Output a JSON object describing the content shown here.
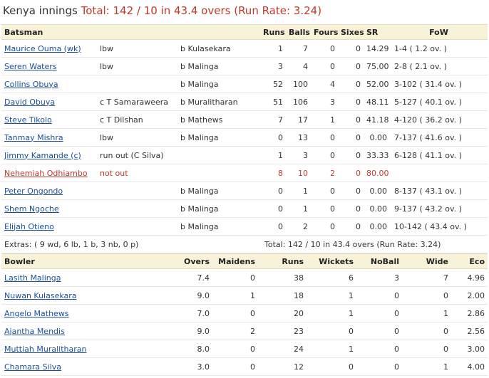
{
  "title": {
    "team": "Kenya innings",
    "total": "Total: 142 / 10 in 43.4 overs (Run Rate: 3.24)"
  },
  "batting": {
    "headers": {
      "batsman": "Batsman",
      "runs": "Runs",
      "balls": "Balls",
      "fours": "Fours",
      "sixes": "Sixes",
      "sr": "SR",
      "fow": "FoW"
    },
    "rows": [
      {
        "name": "Maurice Ouma (wk)",
        "how": "lbw",
        "bowler": "b Kulasekara",
        "runs": "1",
        "balls": "7",
        "fours": "0",
        "sixes": "0",
        "sr": "14.29",
        "fow": "1-4 ( 1.2 ov. )"
      },
      {
        "name": "Seren Waters",
        "how": "lbw",
        "bowler": "b Malinga",
        "runs": "3",
        "balls": "4",
        "fours": "0",
        "sixes": "0",
        "sr": "75.00",
        "fow": "2-8 ( 2.1 ov. )"
      },
      {
        "name": "Collins Obuya",
        "how": "",
        "bowler": "b Malinga",
        "runs": "52",
        "balls": "100",
        "fours": "4",
        "sixes": "0",
        "sr": "52.00",
        "fow": "3-102 ( 31.4 ov. )"
      },
      {
        "name": "David Obuya",
        "how": "c T Samaraweera",
        "bowler": "b Muralitharan",
        "runs": "51",
        "balls": "106",
        "fours": "3",
        "sixes": "0",
        "sr": "48.11",
        "fow": "5-127 ( 40.1 ov. )"
      },
      {
        "name": "Steve Tikolo",
        "how": "c T Dilshan",
        "bowler": "b Mathews",
        "runs": "7",
        "balls": "17",
        "fours": "1",
        "sixes": "0",
        "sr": "41.18",
        "fow": "4-120 ( 36.2 ov. )"
      },
      {
        "name": "Tanmay Mishra",
        "how": "lbw",
        "bowler": "b Malinga",
        "runs": "0",
        "balls": "13",
        "fours": "0",
        "sixes": "0",
        "sr": "0.00",
        "fow": "7-137 ( 41.6 ov. )"
      },
      {
        "name": "Jimmy Kamande (c)",
        "how": "run out (C Silva)",
        "bowler": "",
        "runs": "1",
        "balls": "3",
        "fours": "0",
        "sixes": "0",
        "sr": "33.33",
        "fow": "6-128 ( 41.1 ov. )"
      },
      {
        "name": "Nehemiah Odhiambo",
        "how": "not out",
        "bowler": "",
        "runs": "8",
        "balls": "10",
        "fours": "2",
        "sixes": "0",
        "sr": "80.00",
        "fow": "",
        "notout": true
      },
      {
        "name": "Peter Ongondo",
        "how": "",
        "bowler": "b Malinga",
        "runs": "0",
        "balls": "1",
        "fours": "0",
        "sixes": "0",
        "sr": "0.00",
        "fow": "8-137 ( 43.1 ov. )"
      },
      {
        "name": "Shem Ngoche",
        "how": "",
        "bowler": "b Malinga",
        "runs": "0",
        "balls": "1",
        "fours": "0",
        "sixes": "0",
        "sr": "0.00",
        "fow": "9-137 ( 43.2 ov. )"
      },
      {
        "name": "Elijah Otieno",
        "how": "",
        "bowler": "b Malinga",
        "runs": "0",
        "balls": "2",
        "fours": "0",
        "sixes": "0",
        "sr": "0.00",
        "fow": "10-142 ( 43.4 ov. )"
      }
    ],
    "extras": "Extras: ( 9 wd, 6 lb, 1 b, 3 nb, 0 p)",
    "total": "Total: 142 / 10 in 43.4 overs (Run Rate: 3.24)"
  },
  "bowling": {
    "headers": {
      "bowler": "Bowler",
      "overs": "Overs",
      "maidens": "Maidens",
      "runs": "Runs",
      "wickets": "Wickets",
      "noball": "NoBall",
      "wide": "Wide",
      "eco": "Eco"
    },
    "rows": [
      {
        "name": "Lasith Malinga",
        "overs": "7.4",
        "maidens": "0",
        "runs": "38",
        "wickets": "6",
        "noball": "3",
        "wide": "7",
        "eco": "4.96"
      },
      {
        "name": "Nuwan Kulasekara",
        "overs": "9.0",
        "maidens": "1",
        "runs": "18",
        "wickets": "1",
        "noball": "0",
        "wide": "0",
        "eco": "2.00"
      },
      {
        "name": "Angelo Mathews",
        "overs": "7.0",
        "maidens": "0",
        "runs": "20",
        "wickets": "1",
        "noball": "0",
        "wide": "1",
        "eco": "2.86"
      },
      {
        "name": "Ajantha Mendis",
        "overs": "9.0",
        "maidens": "2",
        "runs": "23",
        "wickets": "0",
        "noball": "0",
        "wide": "0",
        "eco": "2.56"
      },
      {
        "name": "Muttiah Muralitharan",
        "overs": "8.0",
        "maidens": "0",
        "runs": "24",
        "wickets": "1",
        "noball": "0",
        "wide": "0",
        "eco": "3.00"
      },
      {
        "name": "Chamara Silva",
        "overs": "3.0",
        "maidens": "0",
        "runs": "12",
        "wickets": "0",
        "noball": "0",
        "wide": "1",
        "eco": "4.00"
      }
    ]
  }
}
